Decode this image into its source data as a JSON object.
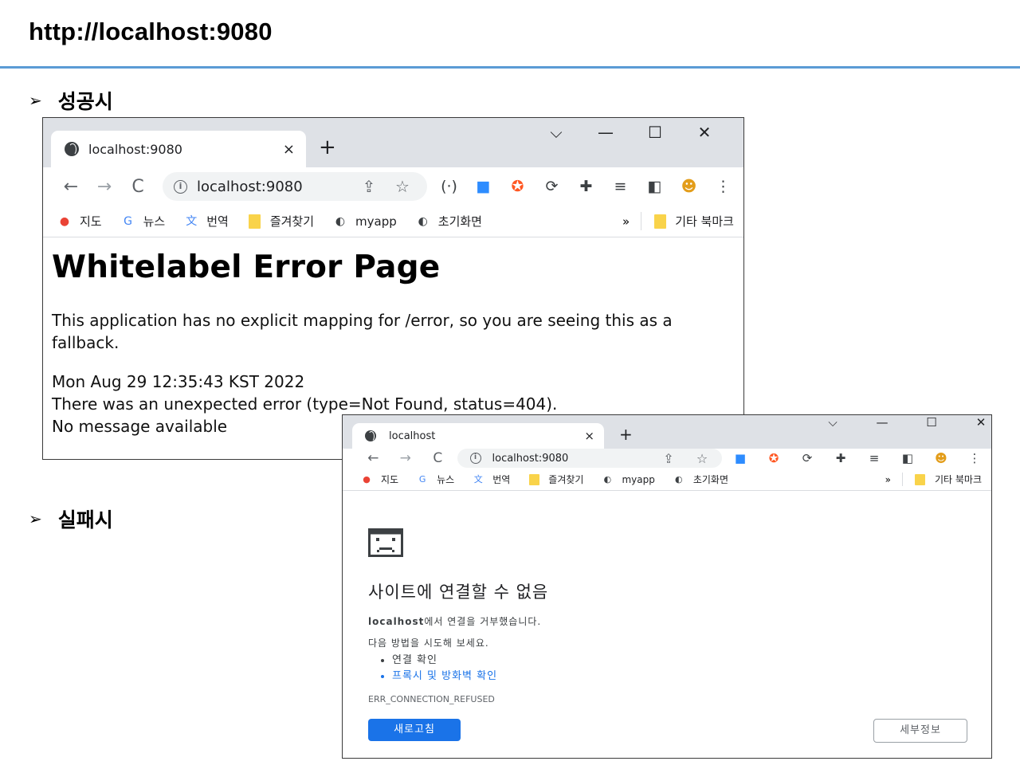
{
  "slide": {
    "title": "http://localhost:9080",
    "bullets": {
      "success": "성공시",
      "failure": "실패시"
    },
    "bullet_glyph": "➢",
    "rule_color": "#5b9bd5"
  },
  "success_window": {
    "tab_title": "localhost:9080",
    "tab_close": "×",
    "new_tab": "+",
    "window_controls": [
      "⌵",
      "—",
      "☐",
      "✕"
    ],
    "nav": {
      "back": "←",
      "forward": "→",
      "reload": "C"
    },
    "url": "localhost:9080",
    "omnibox_icons": [
      "share-icon",
      "star-icon"
    ],
    "omnibox_glyphs": [
      "⇪",
      "☆"
    ],
    "extensions": [
      {
        "name": "code-ext-icon",
        "glyph": "(·)",
        "color": "#3c4043"
      },
      {
        "name": "zoom-ext-icon",
        "glyph": "■",
        "color": "#2d8cff"
      },
      {
        "name": "lifebuoy-ext-icon",
        "glyph": "✪",
        "color": "#ff5722"
      },
      {
        "name": "sync-ext-icon",
        "glyph": "⟳",
        "color": "#3c4043"
      },
      {
        "name": "puzzle-ext-icon",
        "glyph": "✚",
        "color": "#3c4043"
      },
      {
        "name": "media-control-icon",
        "glyph": "≡",
        "color": "#3c4043"
      },
      {
        "name": "sidepanel-icon",
        "glyph": "◧",
        "color": "#3c4043"
      },
      {
        "name": "profile-avatar-icon",
        "glyph": "☻",
        "color": "#e39d1a"
      },
      {
        "name": "menu-kebab-icon",
        "glyph": "⋮",
        "color": "#3c4043"
      }
    ],
    "bookmarks": [
      {
        "name": "bookmark-maps",
        "label": "지도",
        "glyph": "●",
        "color": "#ea4335"
      },
      {
        "name": "bookmark-news",
        "label": "뉴스",
        "glyph": "G",
        "color": "#4285f4"
      },
      {
        "name": "bookmark-translate",
        "label": "번역",
        "glyph": "文",
        "color": "#4285f4"
      },
      {
        "name": "bookmark-favorites",
        "label": "즐겨찾기",
        "folder": true
      },
      {
        "name": "bookmark-myapp",
        "label": "myapp",
        "glyph": "◐",
        "color": "#3c4043"
      },
      {
        "name": "bookmark-home",
        "label": "초기화면",
        "glyph": "◐",
        "color": "#3c4043"
      }
    ],
    "more_bookmarks": "»",
    "other_bookmarks": "기타 북마크",
    "page": {
      "heading": "Whitelabel Error Page",
      "fallback_text": "This application has no explicit mapping for /error, so you are seeing this as a fallback.",
      "timestamp": "Mon Aug 29 12:35:43 KST 2022",
      "error_text": "There was an unexpected error (type=Not Found, status=404).",
      "message": "No message available"
    }
  },
  "failure_window": {
    "tab_title": "localhost",
    "tab_close": "×",
    "new_tab": "+",
    "window_controls": [
      "⌵",
      "—",
      "☐",
      "✕"
    ],
    "nav": {
      "back": "←",
      "forward": "→",
      "reload": "C"
    },
    "url": "localhost:9080",
    "omnibox_glyphs": [
      "⇪",
      "☆"
    ],
    "extensions": [
      {
        "name": "zoom-ext-icon",
        "glyph": "■",
        "color": "#2d8cff"
      },
      {
        "name": "lifebuoy-ext-icon",
        "glyph": "✪",
        "color": "#ff5722"
      },
      {
        "name": "sync-ext-icon",
        "glyph": "⟳",
        "color": "#3c4043"
      },
      {
        "name": "puzzle-ext-icon",
        "glyph": "✚",
        "color": "#3c4043"
      },
      {
        "name": "media-control-icon",
        "glyph": "≡",
        "color": "#3c4043"
      },
      {
        "name": "sidepanel-icon",
        "glyph": "◧",
        "color": "#3c4043"
      },
      {
        "name": "profile-avatar-icon",
        "glyph": "☻",
        "color": "#e39d1a"
      },
      {
        "name": "menu-kebab-icon",
        "glyph": "⋮",
        "color": "#3c4043"
      }
    ],
    "bookmarks": [
      {
        "name": "bookmark-maps",
        "label": "지도",
        "glyph": "●",
        "color": "#ea4335"
      },
      {
        "name": "bookmark-news",
        "label": "뉴스",
        "glyph": "G",
        "color": "#4285f4"
      },
      {
        "name": "bookmark-translate",
        "label": "번역",
        "glyph": "文",
        "color": "#4285f4"
      },
      {
        "name": "bookmark-favorites",
        "label": "즐겨찾기",
        "folder": true
      },
      {
        "name": "bookmark-myapp",
        "label": "myapp",
        "glyph": "◐",
        "color": "#3c4043"
      },
      {
        "name": "bookmark-home",
        "label": "초기화면",
        "glyph": "◐",
        "color": "#3c4043"
      }
    ],
    "more_bookmarks": "»",
    "other_bookmarks": "기타 북마크",
    "page": {
      "title": "사이트에 연결할 수 없음",
      "refused_host": "localhost",
      "refused_text": "에서 연결을 거부했습니다.",
      "suggest_intro": "다음 방법을 시도해 보세요.",
      "suggestions": [
        "연결 확인",
        "프록시 및 방화벽 확인"
      ],
      "error_code": "ERR_CONNECTION_REFUSED",
      "reload_label": "새로고침",
      "details_label": "세부정보",
      "button_color": "#1a73e8",
      "link_color": "#1a73e8"
    }
  }
}
